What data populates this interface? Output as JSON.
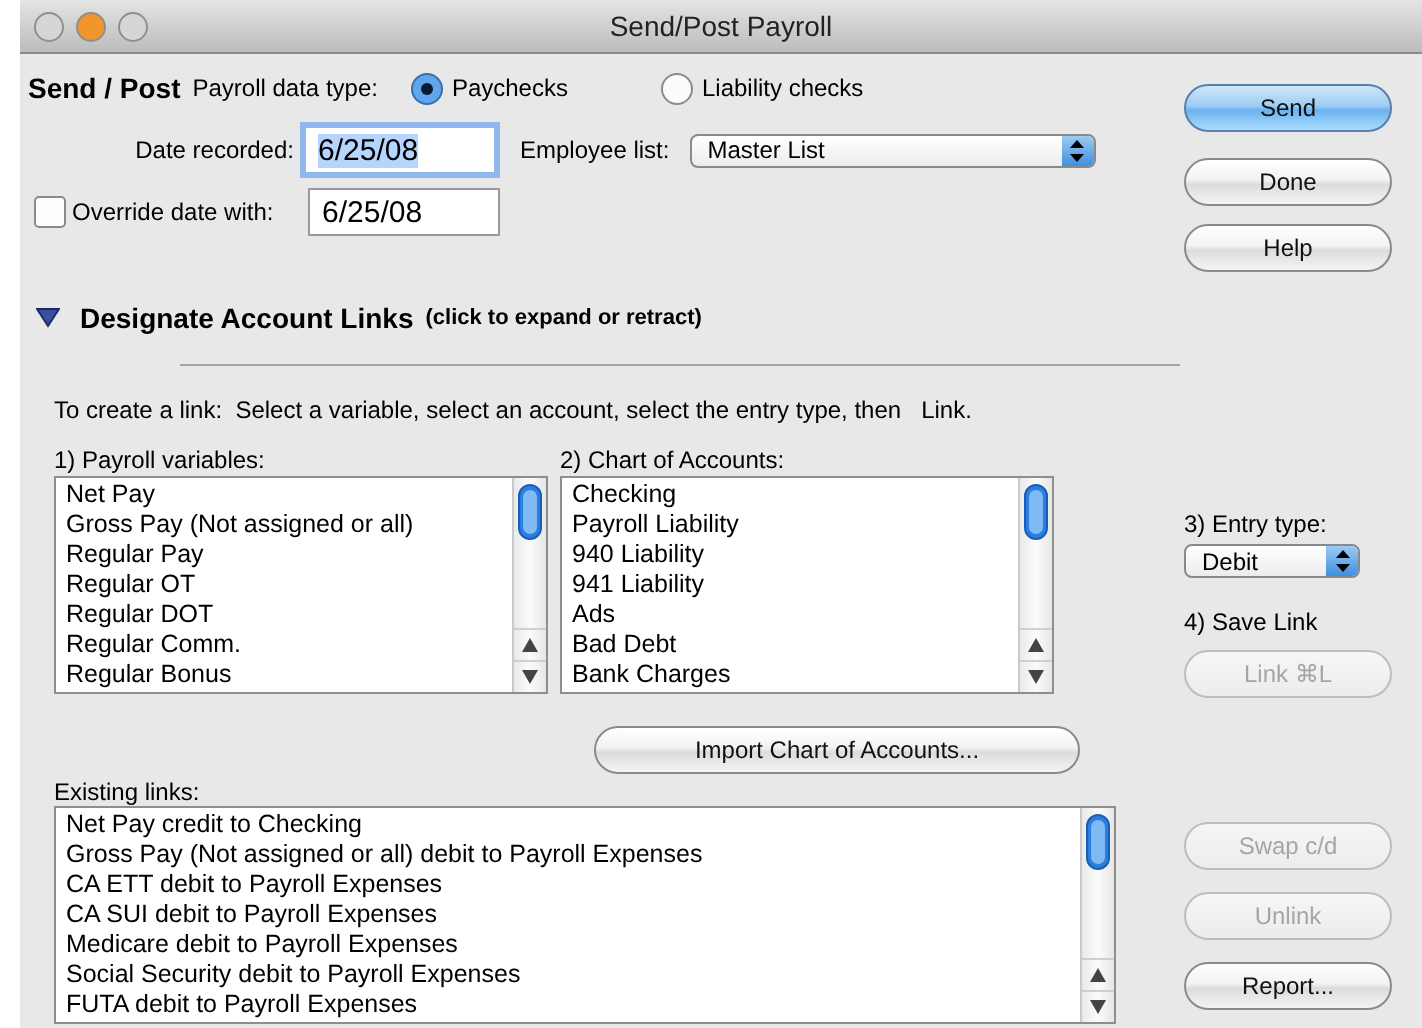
{
  "window": {
    "title": "Send/Post Payroll"
  },
  "header": {
    "heading": "Send / Post",
    "data_type_label": "Payroll data type:",
    "data_types": [
      {
        "label": "Paychecks",
        "selected": true
      },
      {
        "label": "Liability checks",
        "selected": false
      }
    ]
  },
  "date_recorded": {
    "label": "Date recorded:",
    "value": "6/25/08",
    "focused": true
  },
  "employee_list": {
    "label": "Employee list:",
    "value": "Master List"
  },
  "override": {
    "label": "Override date with:",
    "checked": false,
    "value": "6/25/08"
  },
  "top_buttons": [
    {
      "label": "Send",
      "default": true,
      "disabled": false
    },
    {
      "label": "Done",
      "default": false,
      "disabled": false
    },
    {
      "label": "Help",
      "default": false,
      "disabled": false
    }
  ],
  "section": {
    "title": "Designate Account Links",
    "hint": "(click to expand or retract)",
    "expanded": true
  },
  "instructions": "To create a link:  Select a variable, select an account, select the entry type, then   Link.",
  "variables": {
    "label": "1) Payroll variables:",
    "items": [
      "Net Pay",
      "Gross Pay (Not assigned or all)",
      "Regular Pay",
      "Regular OT",
      "Regular DOT",
      "Regular Comm.",
      "Regular Bonus"
    ]
  },
  "accounts": {
    "label": "2) Chart of Accounts:",
    "items": [
      "Checking",
      "Payroll Liability",
      "940 Liability",
      "941 Liability",
      "Ads",
      "Bad Debt",
      "Bank Charges"
    ]
  },
  "entry_type": {
    "label": "3) Entry type:",
    "value": "Debit"
  },
  "save_link": {
    "label": "4) Save Link",
    "button": {
      "label": "Link ⌘L",
      "disabled": true
    }
  },
  "import_button": {
    "label": "Import Chart of Accounts...",
    "disabled": false
  },
  "existing_links": {
    "label": "Existing links:",
    "items": [
      "Net Pay credit to Checking",
      "Gross Pay (Not assigned or all) debit to Payroll Expenses",
      "CA ETT debit to Payroll Expenses",
      "CA SUI debit to Payroll Expenses",
      "Medicare debit to Payroll Expenses",
      "Social Security debit to Payroll Expenses",
      "FUTA debit to Payroll Expenses"
    ]
  },
  "link_buttons": [
    {
      "label": "Swap c/d",
      "disabled": true
    },
    {
      "label": "Unlink",
      "disabled": true
    },
    {
      "label": "Report...",
      "disabled": false
    }
  ]
}
